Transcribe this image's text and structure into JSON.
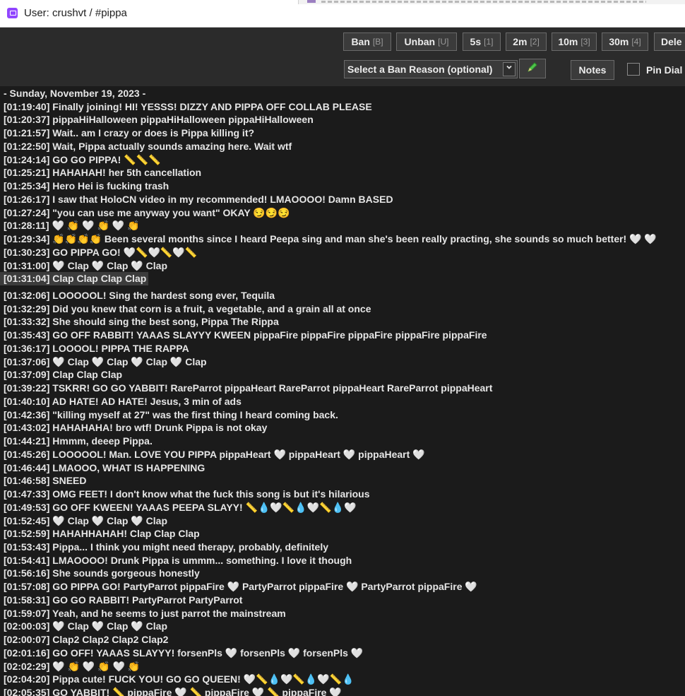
{
  "window": {
    "title": "User: crushvt / #pippa"
  },
  "toolbar": {
    "ban": {
      "label": "Ban",
      "hint": "[B]"
    },
    "unban": {
      "label": "Unban",
      "hint": "[U]"
    },
    "t5s": {
      "label": "5s",
      "hint": "[1]"
    },
    "t2m": {
      "label": "2m",
      "hint": "[2]"
    },
    "t10m": {
      "label": "10m",
      "hint": "[3]"
    },
    "t30m": {
      "label": "30m",
      "hint": "[4]"
    },
    "delete": {
      "label": "Dele"
    },
    "ban_reason": {
      "label": "Select a Ban Reason (optional)"
    },
    "notes": "Notes",
    "pin": "Pin Dial"
  },
  "chat": {
    "date": "- Sunday, November 19, 2023 -",
    "messages": [
      {
        "ts": "[01:19:40]",
        "text": "Finally joining! HI! YESSS! DIZZY AND PIPPA OFF COLLAB PLEASE"
      },
      {
        "ts": "[01:20:37]",
        "text": "pippaHiHalloween pippaHiHalloween pippaHiHalloween"
      },
      {
        "ts": "[01:21:57]",
        "text": "Wait.. am I crazy or does is Pippa killing it?"
      },
      {
        "ts": "[01:22:50]",
        "text": "Wait, Pippa actually sounds amazing here. Wait wtf"
      },
      {
        "ts": "[01:24:14]",
        "text": "GO GO PIPPA! 📏📏📏"
      },
      {
        "ts": "[01:25:21]",
        "text": "HAHAHAH! her 5th cancellation"
      },
      {
        "ts": "[01:25:34]",
        "text": "Hero Hei is fucking trash"
      },
      {
        "ts": "[01:26:17]",
        "text": "I saw that HoloCN video in my recommended! LMAOOOO! Damn BASED"
      },
      {
        "ts": "[01:27:24]",
        "text": "\"you can use me anyway you want\" OKAY 😏😏😏"
      },
      {
        "ts": "[01:28:11]",
        "text": "🤍 👏 🤍 👏 🤍 👏"
      },
      {
        "ts": "[01:29:34]",
        "text": "👏👏👏👏 Been several months since I heard Peepa sing and man she's been really practing, she sounds so much better! 🤍 🤍"
      },
      {
        "ts": "[01:30:23]",
        "text": "GO PIPPA GO! 🤍📏🤍📏🤍📏"
      },
      {
        "ts": "[01:31:00]",
        "text": "🤍 Clap 🤍 Clap 🤍 Clap"
      },
      {
        "ts": "[01:31:04]",
        "text": "Clap Clap Clap Clap"
      },
      {
        "ts": "[01:32:06]",
        "text": "LOOOOOL! Sing the hardest song ever, Tequila"
      },
      {
        "ts": "[01:32:29]",
        "text": "Did you knew that corn is a fruit, a vegetable, and a grain all at once"
      },
      {
        "ts": "[01:33:32]",
        "text": "She should sing the best song, Pippa The Rippa"
      },
      {
        "ts": "[01:35:43]",
        "text": "GO OFF RABBIT! YAAAS SLAYYY KWEEN pippaFire pippaFire pippaFire pippaFire pippaFire"
      },
      {
        "ts": "[01:36:17]",
        "text": "LOOOOL! PIPPA THE RAPPA"
      },
      {
        "ts": "[01:37:06]",
        "text": "🤍 Clap  🤍 Clap  🤍 Clap  🤍 Clap"
      },
      {
        "ts": "[01:37:09]",
        "text": "Clap Clap Clap"
      },
      {
        "ts": "[01:39:22]",
        "text": "TSKRR! GO GO YABBIT! RareParrot pippaHeart RareParrot pippaHeart RareParrot pippaHeart"
      },
      {
        "ts": "[01:40:10]",
        "text": "AD HATE! AD HATE! Jesus, 3 min of ads"
      },
      {
        "ts": "[01:42:36]",
        "text": "\"killing myself at 27\" was the first thing I heard coming back."
      },
      {
        "ts": "[01:43:02]",
        "text": "HAHAHAHA! bro wtf! Drunk Pippa is not okay"
      },
      {
        "ts": "[01:44:21]",
        "text": "Hmmm, deeep Pippa."
      },
      {
        "ts": "[01:45:26]",
        "text": "LOOOOOL! Man. LOVE YOU PIPPA pippaHeart 🤍  pippaHeart 🤍  pippaHeart 🤍"
      },
      {
        "ts": "[01:46:44]",
        "text": "LMAOOO, WHAT IS HAPPENING"
      },
      {
        "ts": "[01:46:58]",
        "text": "SNEED"
      },
      {
        "ts": "[01:47:33]",
        "text": "OMG FEET! I don't know what the fuck this song is but it's hilarious"
      },
      {
        "ts": "[01:49:53]",
        "text": "GO OFF KWEEN! YAAAS PEEPA SLAYY!  📏💧🤍📏💧🤍📏💧🤍"
      },
      {
        "ts": "[01:52:45]",
        "text": "🤍 Clap 🤍 Clap 🤍 Clap"
      },
      {
        "ts": "[01:52:59]",
        "text": "HAHAHHAHAH! Clap  Clap  Clap"
      },
      {
        "ts": "[01:53:43]",
        "text": "Pippa... I think you might need therapy, probably, definitely"
      },
      {
        "ts": "[01:54:41]",
        "text": "LMAOOOO! Drunk Pippa is ummm... something. I love it though"
      },
      {
        "ts": "[01:56:16]",
        "text": "She sounds gorgeous honestly"
      },
      {
        "ts": "[01:57:08]",
        "text": "GO PIPPA GO! PartyParrot pippaFire 🤍 PartyParrot pippaFire 🤍 PartyParrot pippaFire 🤍"
      },
      {
        "ts": "[01:58:31]",
        "text": "GO GO RABBIT! PartyParrot PartyParrot"
      },
      {
        "ts": "[01:59:07]",
        "text": "Yeah, and he seems to just parrot the mainstream"
      },
      {
        "ts": "[02:00:03]",
        "text": "🤍 Clap  🤍 Clap  🤍 Clap"
      },
      {
        "ts": "[02:00:07]",
        "text": "Clap2 Clap2 Clap2 Clap2"
      },
      {
        "ts": "[02:01:16]",
        "text": "GO OFF! YAAAS SLAYYY! forsenPls 🤍 forsenPls 🤍 forsenPls 🤍"
      },
      {
        "ts": "[02:02:29]",
        "text": "🤍 👏 🤍 👏 🤍 👏"
      },
      {
        "ts": "[02:04:20]",
        "text": "Pippa cute! FUCK YOU! GO GO QUEEN! 🤍📏💧🤍📏💧🤍📏💧"
      },
      {
        "ts": "[02:05:35]",
        "text": "GO YABBIT! 📏 pippaFire 🤍 📏 pippaFire 🤍 📏 pippaFire 🤍"
      }
    ]
  }
}
